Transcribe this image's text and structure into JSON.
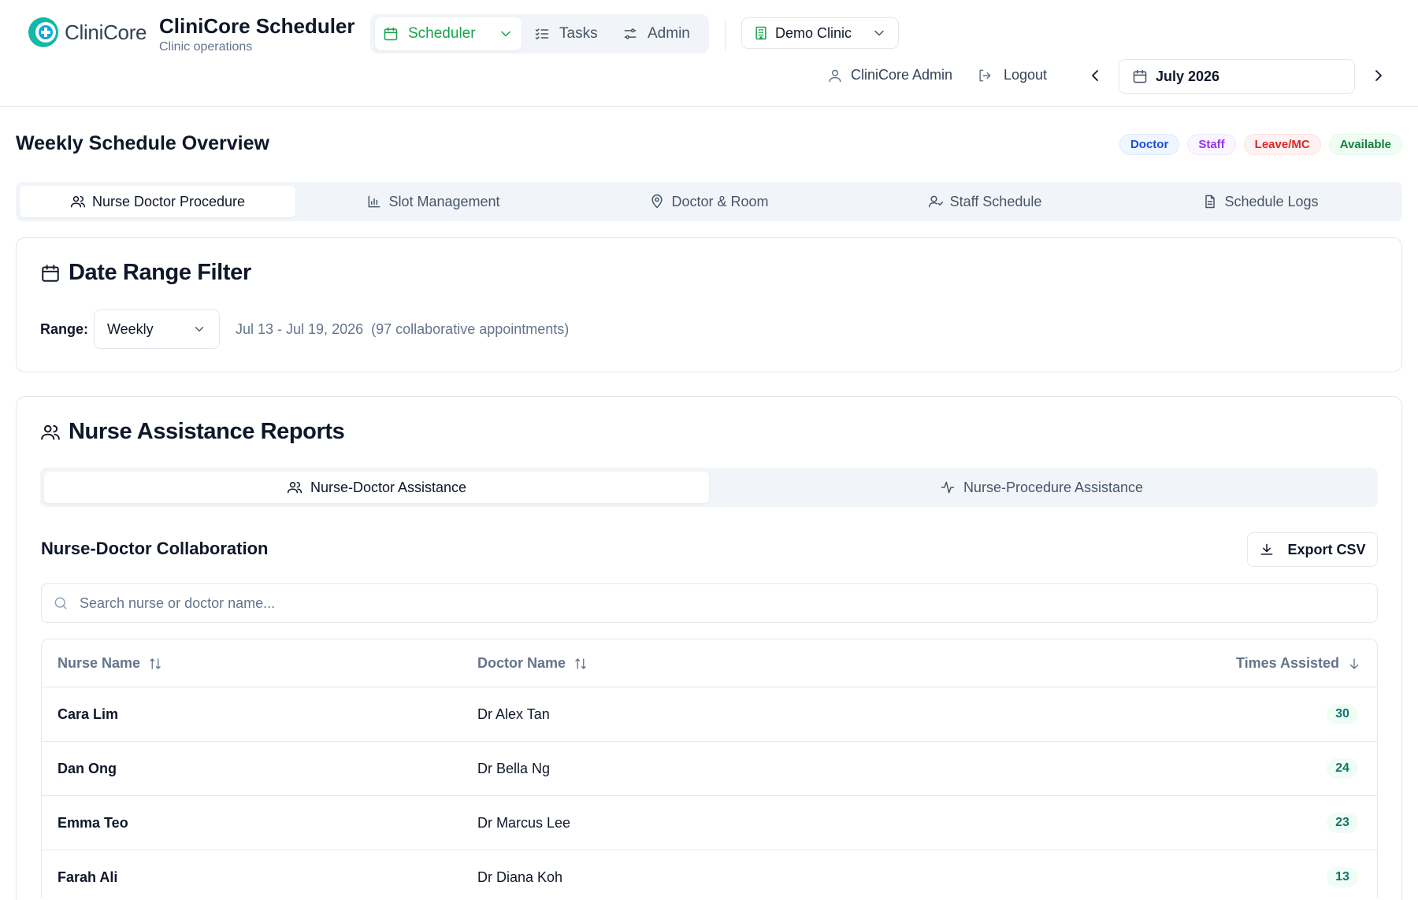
{
  "header": {
    "logo_text": "CliniCore",
    "app_title": "CliniCore Scheduler",
    "app_subtitle": "Clinic operations",
    "nav": [
      {
        "label": "Scheduler",
        "icon": "calendar-icon",
        "active": true
      },
      {
        "label": "Tasks",
        "icon": "list-checks-icon"
      },
      {
        "label": "Admin",
        "icon": "sliders-icon"
      }
    ],
    "clinic": "Demo Clinic",
    "user": "CliniCore Admin",
    "logout": "Logout",
    "month": "July 2026"
  },
  "overview": {
    "title": "Weekly Schedule Overview",
    "legend": [
      {
        "label": "Doctor",
        "color": "#1d4ed8"
      },
      {
        "label": "Staff",
        "color": "#9333ea"
      },
      {
        "label": "Leave/MC",
        "color": "#dc2626"
      },
      {
        "label": "Available",
        "color": "#15803d"
      }
    ],
    "tabs": [
      {
        "label": "Nurse Doctor Procedure",
        "icon": "users-icon",
        "active": true
      },
      {
        "label": "Slot Management",
        "icon": "bar-chart-icon"
      },
      {
        "label": "Doctor & Room",
        "icon": "map-pin-icon"
      },
      {
        "label": "Staff Schedule",
        "icon": "user-check-icon"
      },
      {
        "label": "Schedule Logs",
        "icon": "file-text-icon"
      }
    ]
  },
  "date_filter": {
    "title": "Date Range Filter",
    "range_label": "Range:",
    "range_value": "Weekly",
    "range_text": "Jul 13 - Jul 19, 2026",
    "appointments_text": "(97 collaborative appointments)"
  },
  "reports": {
    "title": "Nurse Assistance Reports",
    "subtabs": [
      {
        "label": "Nurse-Doctor Assistance",
        "icon": "users-icon",
        "active": true
      },
      {
        "label": "Nurse-Procedure Assistance",
        "icon": "activity-icon"
      }
    ],
    "section_title": "Nurse-Doctor Collaboration",
    "export_label": "Export CSV",
    "search_placeholder": "Search nurse or doctor name...",
    "columns": {
      "nurse": "Nurse Name",
      "doctor": "Doctor Name",
      "times": "Times Assisted"
    },
    "rows": [
      {
        "nurse": "Cara Lim",
        "doctor": "Dr Alex Tan",
        "times": "30"
      },
      {
        "nurse": "Dan Ong",
        "doctor": "Dr Bella Ng",
        "times": "24"
      },
      {
        "nurse": "Emma Teo",
        "doctor": "Dr Marcus Lee",
        "times": "23"
      },
      {
        "nurse": "Farah Ali",
        "doctor": "Dr Diana Koh",
        "times": "13"
      }
    ]
  },
  "colors": {
    "accent": "#16a34a",
    "count_text": "#0f766e"
  }
}
